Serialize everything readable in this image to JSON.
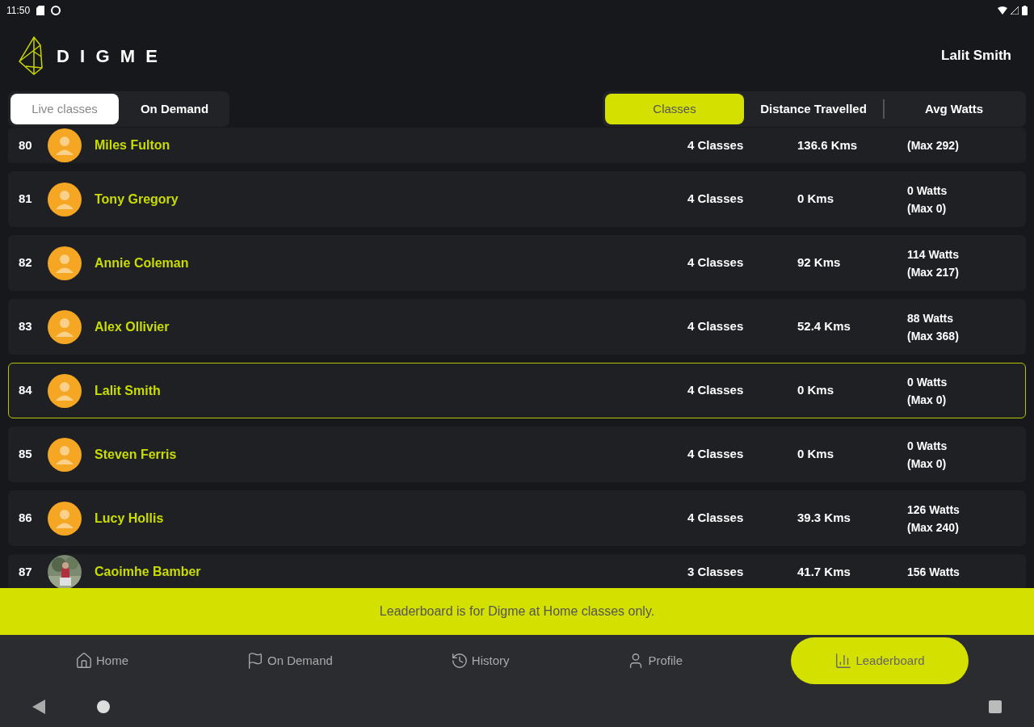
{
  "status_bar": {
    "time": "11:50"
  },
  "header": {
    "brand": "DIGME",
    "user": "Lalit Smith"
  },
  "mode_tabs": [
    {
      "label": "Live classes",
      "selected": true
    },
    {
      "label": "On Demand",
      "selected": false
    }
  ],
  "metric_tabs": [
    {
      "label": "Classes",
      "selected": true
    },
    {
      "label": "Distance Travelled",
      "selected": false
    },
    {
      "label": "Avg Watts",
      "selected": false
    }
  ],
  "rows": [
    {
      "rank": "80",
      "name": "Miles Fulton",
      "kind": "default",
      "classes": "4 Classes",
      "distance": "136.6 Kms",
      "watts": [
        "(Max 292)"
      ],
      "selected": false
    },
    {
      "rank": "81",
      "name": "Tony Gregory",
      "kind": "default",
      "classes": "4 Classes",
      "distance": "0 Kms",
      "watts": [
        "0 Watts",
        "(Max 0)"
      ],
      "selected": false
    },
    {
      "rank": "82",
      "name": "Annie Coleman",
      "kind": "default",
      "classes": "4 Classes",
      "distance": "92 Kms",
      "watts": [
        "114 Watts",
        "(Max 217)"
      ],
      "selected": false
    },
    {
      "rank": "83",
      "name": "Alex Ollivier",
      "kind": "default",
      "classes": "4 Classes",
      "distance": "52.4 Kms",
      "watts": [
        "88 Watts",
        "(Max 368)"
      ],
      "selected": false
    },
    {
      "rank": "84",
      "name": "Lalit Smith",
      "kind": "default",
      "classes": "4 Classes",
      "distance": "0 Kms",
      "watts": [
        "0 Watts",
        "(Max 0)"
      ],
      "selected": true
    },
    {
      "rank": "85",
      "name": "Steven Ferris",
      "kind": "default",
      "classes": "4 Classes",
      "distance": "0 Kms",
      "watts": [
        "0 Watts",
        "(Max 0)"
      ],
      "selected": false
    },
    {
      "rank": "86",
      "name": "Lucy Hollis",
      "kind": "default",
      "classes": "4 Classes",
      "distance": "39.3 Kms",
      "watts": [
        "126 Watts",
        "(Max 240)"
      ],
      "selected": false
    },
    {
      "rank": "87",
      "name": "Caoimhe Bamber",
      "classes": "3 Classes",
      "distance": "41.7 Kms",
      "watts": [
        "156 Watts"
      ],
      "selected": false
    }
  ],
  "banner": "Leaderboard is for Digme at Home classes only.",
  "bottom_nav": [
    {
      "label": "Home",
      "selected": false
    },
    {
      "label": "On Demand",
      "selected": false
    },
    {
      "label": "History",
      "selected": false
    },
    {
      "label": "Profile",
      "selected": false
    },
    {
      "label": "Leaderboard",
      "selected": true
    }
  ]
}
